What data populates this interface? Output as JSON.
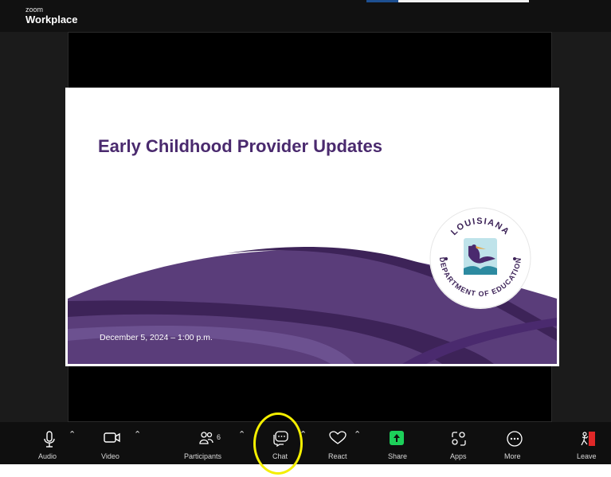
{
  "brand": {
    "small": "zoom",
    "name": "Workplace"
  },
  "slide": {
    "title": "Early Childhood Provider Updates",
    "date": "December 5, 2024 – 1:00 p.m.",
    "seal_text_top": "LOUISIANA",
    "seal_text_bottom": "DEPARTMENT OF EDUCATION"
  },
  "toolbar": {
    "audio": "Audio",
    "video": "Video",
    "participants": "Participants",
    "participants_count": "6",
    "chat": "Chat",
    "react": "React",
    "share": "Share",
    "apps": "Apps",
    "more": "More",
    "leave": "Leave"
  },
  "colors": {
    "slide_purple": "#4a2a6e",
    "wave_purple": "#5a3d7a",
    "share_green": "#1dd05a",
    "leave_red": "#e02828",
    "highlight": "#f4ef00"
  }
}
